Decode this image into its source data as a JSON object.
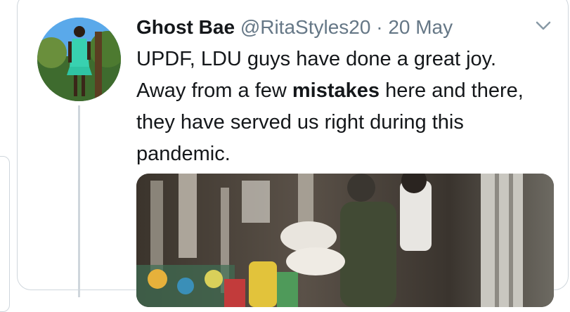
{
  "tweet": {
    "display_name": "Ghost Bae",
    "handle": "@RitaStyles20",
    "separator": "·",
    "date": "20 May",
    "text_before": "UPDF, LDU guys have done a great joy. Away from a few ",
    "text_bold": "mistakes",
    "text_after": " here and there, they have served us right during this pandemic."
  },
  "icons": {
    "menu": "chevron-down-icon"
  },
  "colors": {
    "name": "#14171a",
    "secondary": "#657786",
    "border": "#cfd6dc"
  }
}
